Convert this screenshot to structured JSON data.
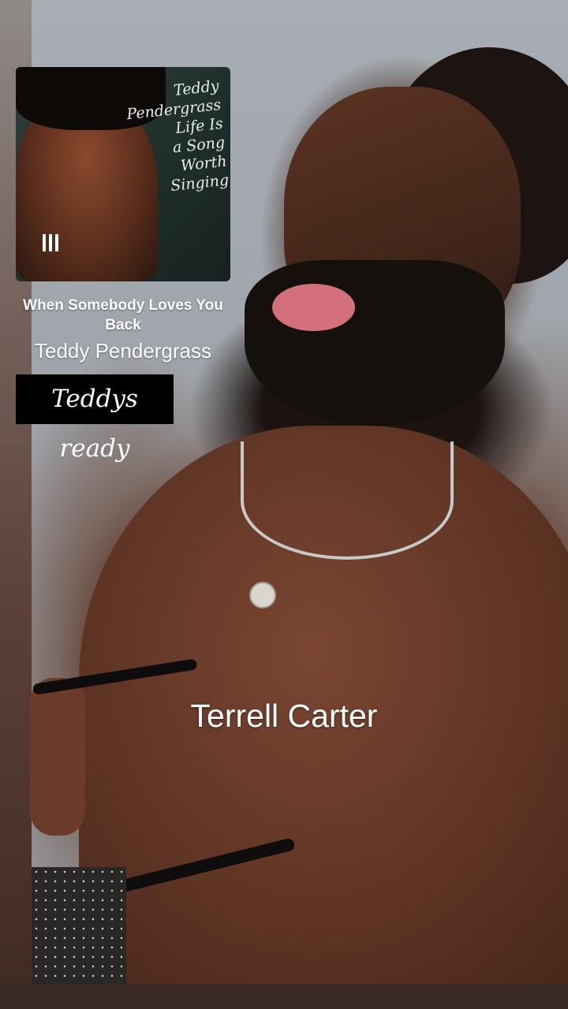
{
  "story": {
    "background_color": "#3b2a24"
  },
  "music_sticker": {
    "album_cover_text": [
      "Teddy",
      "Pendergrass",
      "Life Is",
      "a Song",
      "Worth",
      "Singing"
    ],
    "song_title": "When Somebody Loves You Back",
    "artist": "Teddy Pendergrass",
    "playback_state_icon": "pause-icon"
  },
  "caption": {
    "text": "Teddys ready",
    "background_color": "#000000",
    "text_color": "#ffffff"
  },
  "name_label": {
    "text": "Terrell Carter",
    "text_color": "#ffffff"
  }
}
